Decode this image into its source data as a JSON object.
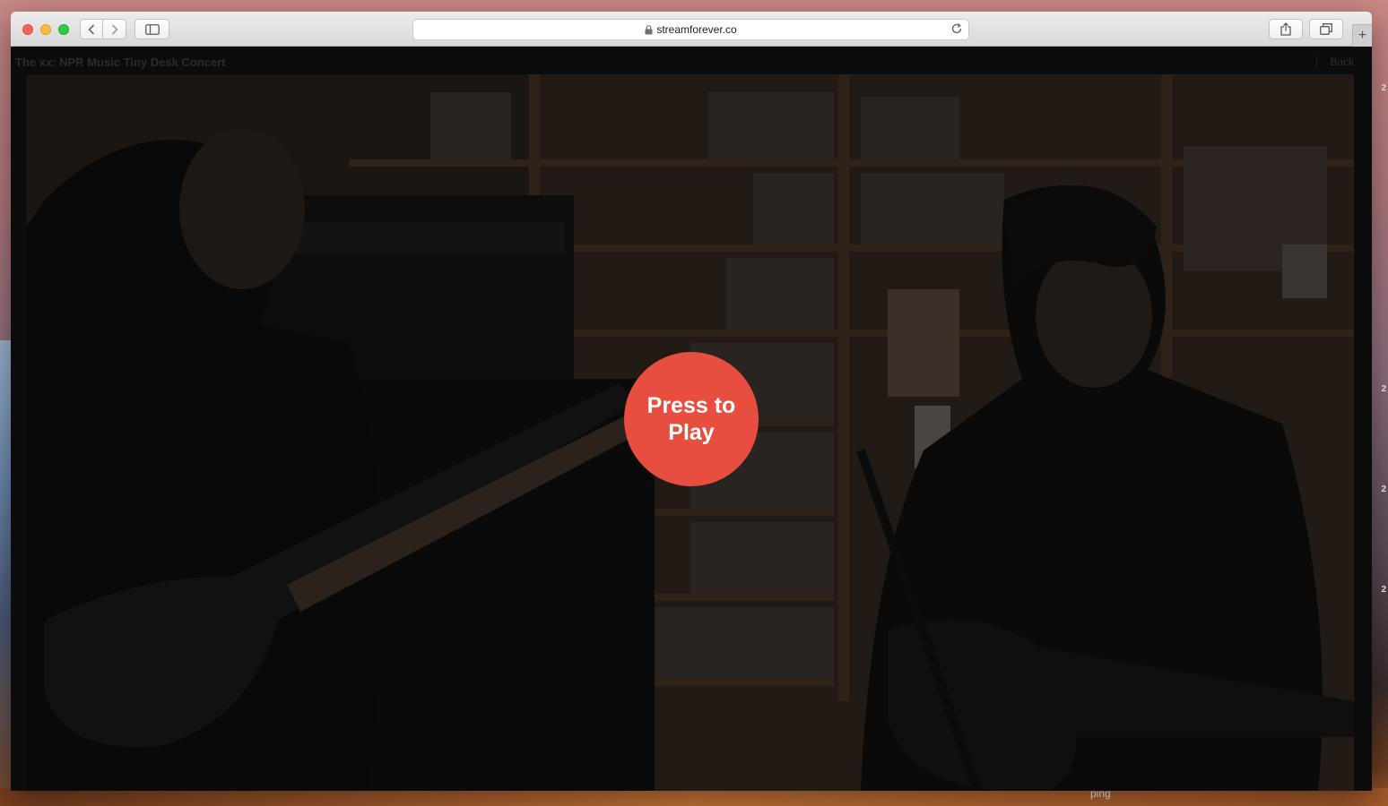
{
  "browser": {
    "url": "streamforever.co"
  },
  "page": {
    "video_title": "The xx: NPR Music Tiny Desk Concert",
    "back_label": "Back",
    "play_label": "Press to Play"
  },
  "desktop": {
    "edge_labels": [
      "2",
      "2",
      "2",
      "2"
    ],
    "dock_hint": "ping"
  },
  "colors": {
    "play_button": "#e84e3f",
    "close_dot": "#fc605c",
    "minimize_dot": "#fdbc40",
    "zoom_dot": "#34c84a"
  }
}
